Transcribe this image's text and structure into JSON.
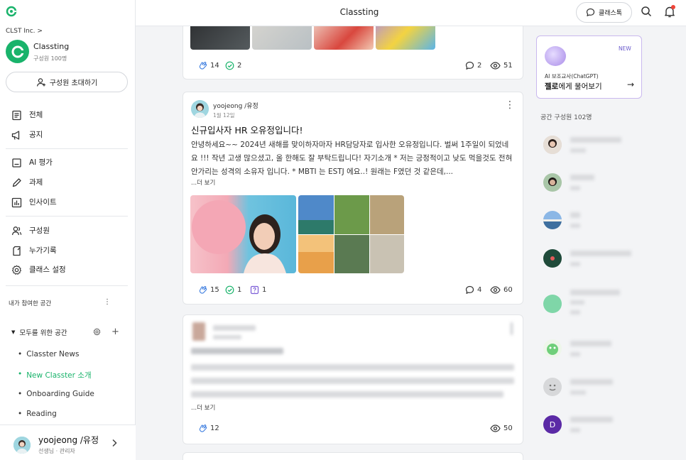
{
  "sidebar": {
    "org": "CLST Inc. >",
    "class_name": "Classting",
    "class_members": "구성원 100명",
    "invite_label": "구성원 초대하기",
    "nav": [
      {
        "label": "전체",
        "icon": "document-icon"
      },
      {
        "label": "공지",
        "icon": "megaphone-icon"
      },
      {
        "label": "AI 평가",
        "icon": "ai-eval-icon"
      },
      {
        "label": "과제",
        "icon": "pencil-icon"
      },
      {
        "label": "인사이트",
        "icon": "chart-icon"
      },
      {
        "label": "구성원",
        "icon": "people-icon"
      },
      {
        "label": "누가기록",
        "icon": "record-icon"
      },
      {
        "label": "클래스 설정",
        "icon": "gear-icon"
      }
    ],
    "joined_spaces_label": "내가 참여한 공간",
    "group": {
      "name": "모두를 위한 공간",
      "items": [
        {
          "label": "Classter News",
          "active": false
        },
        {
          "label": "New Classter 소개",
          "active": true
        },
        {
          "label": "Onboarding Guide",
          "active": false
        },
        {
          "label": "Reading",
          "active": false
        }
      ]
    },
    "user": {
      "name": "yoojeong /유정",
      "role": "선생님 · 관리자"
    }
  },
  "topbar": {
    "title": "Classting",
    "talk_label": "클래스톡"
  },
  "posts": [
    {
      "likes": "14",
      "checks": "2",
      "comments": "2",
      "views": "51"
    },
    {
      "author": "yoojeong /유정",
      "date": "1월 12일",
      "title": "신규입사자 HR 오유정입니다!",
      "body": "안녕하세요~~ 2024년 새해를 맞이하자마자 HR담당자로 입사한 오유정입니다. 벌써 1주일이 되었네요 !!! 작년 고생 많으셨고, 올 한해도 잘 부탁드립니다! 자기소개 * 저는 긍정적이고 낮도 먹을것도 전혀 안가리는 성격의 소유자 입니다. * MBTI 는 ESTJ 에요..! 원래는 F였던 것 같은데,...",
      "more": "...더 보기",
      "likes": "15",
      "checks": "1",
      "questions": "1",
      "comments": "4",
      "views": "60"
    },
    {
      "more": "...더 보기",
      "likes": "12",
      "views": "50"
    }
  ],
  "right": {
    "ai_new": "NEW",
    "ai_sub": "AI 보조교사(ChatGPT)",
    "ai_main_bold": "젤로",
    "ai_main_rest": "에게 물어보기",
    "members_head": "공간 구성원 102명",
    "member_d": "D"
  },
  "colors": {
    "brand": "#19b36b",
    "accent_purple": "#6a5acd"
  }
}
